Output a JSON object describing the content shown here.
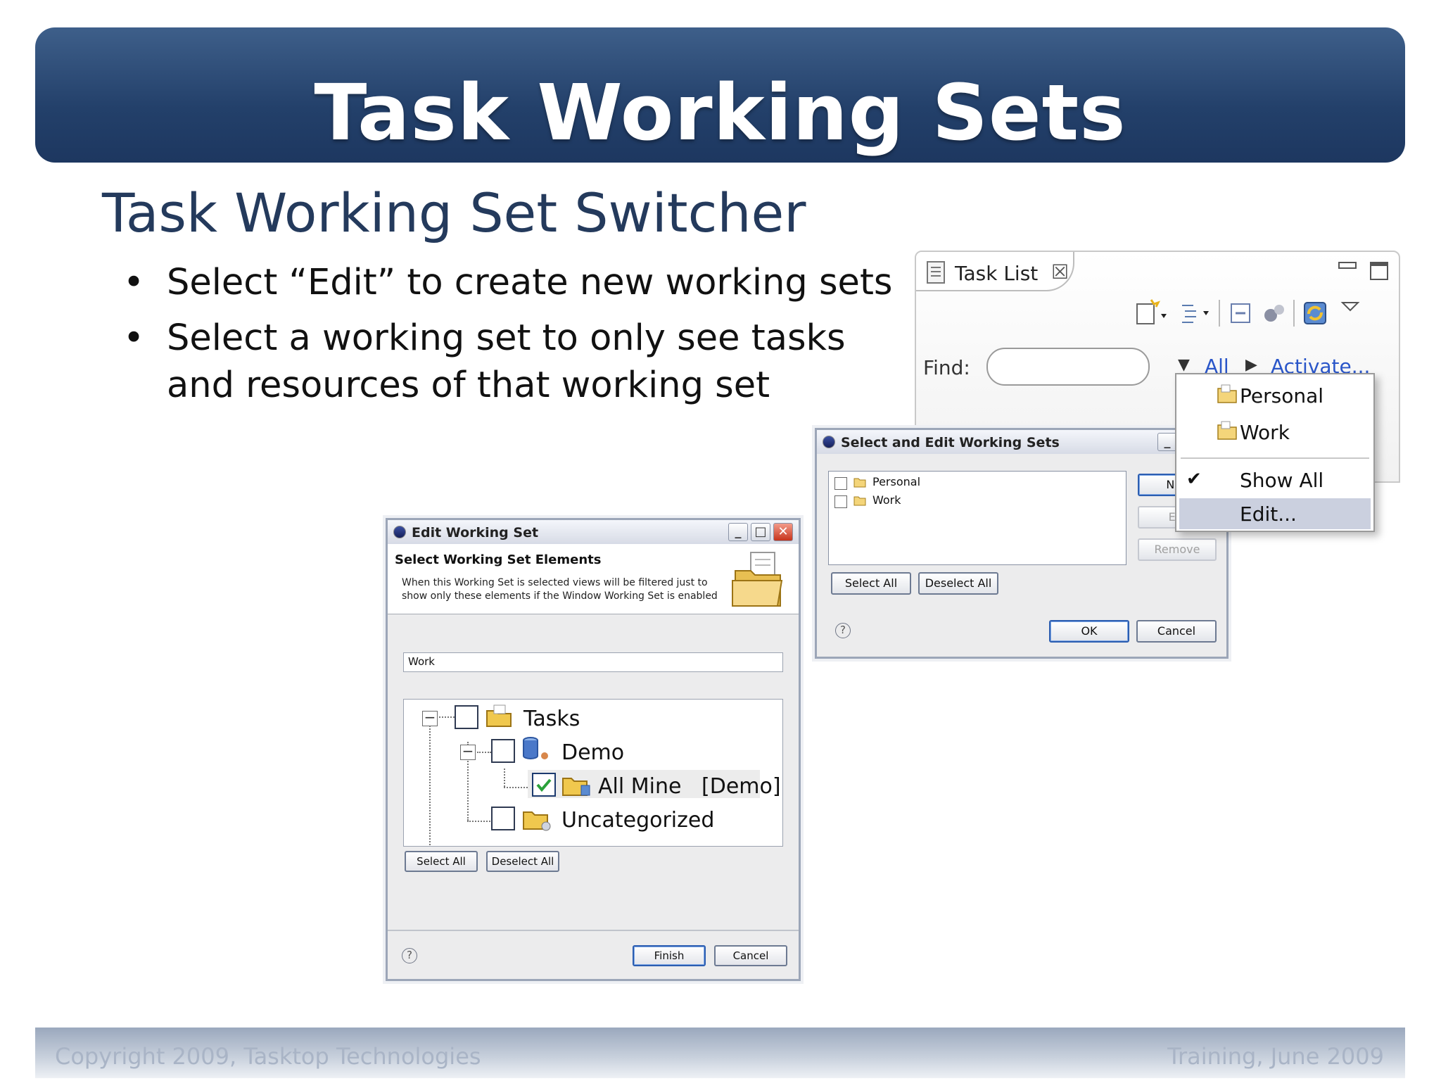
{
  "slide": {
    "title": "Task Working Sets",
    "subtitle": "Task Working Set Switcher",
    "bullets": [
      "Select “Edit” to create new working sets",
      "Select a working set to only see tasks and resources of that working set"
    ],
    "bullet_char": "•",
    "footer_left": "Copyright 2009, Tasktop Technologies",
    "footer_right": "Training, June 2009",
    "colors": {
      "title_bar": "#23406a",
      "subtitle": "#243a5c",
      "link": "#2a56c9",
      "menu_highlight": "#cbd0df"
    }
  },
  "task_list": {
    "tab_label": "Task List",
    "tab_close": "☒",
    "find_label": "Find:",
    "find_value": "",
    "filter_link": "All",
    "activate_link": "Activate...",
    "menu": {
      "items": [
        {
          "label": "Personal",
          "icon": "working-set-folder-icon",
          "checked": false
        },
        {
          "label": "Work",
          "icon": "working-set-folder-icon",
          "checked": false
        },
        {
          "label": "Show All",
          "checked": true
        },
        {
          "label": "Edit...",
          "highlighted": true
        }
      ]
    }
  },
  "select_edit_dialog": {
    "title": "Select and Edit Working Sets",
    "sets": [
      {
        "label": "Personal",
        "checked": false
      },
      {
        "label": "Work",
        "checked": false
      }
    ],
    "side_buttons": [
      "New...",
      "Edit...",
      "Remove"
    ],
    "side_buttons_visible": [
      "Nev",
      "Edi",
      "Remove"
    ],
    "select_all": "Select All",
    "deselect_all": "Deselect All",
    "ok": "OK",
    "cancel": "Cancel",
    "help": "?"
  },
  "edit_dialog": {
    "title": "Edit Working Set",
    "heading": "Select Working Set Elements",
    "description": "When this Working Set is selected views will be filtered just to show only these elements if the Window Working Set is enabled",
    "name_value": "Work",
    "tree": [
      {
        "label": "Tasks",
        "checked": false,
        "expanded": true,
        "icon": "tasks-folder-icon"
      },
      {
        "label": "Demo",
        "checked": false,
        "expanded": true,
        "icon": "repository-icon"
      },
      {
        "label": "All Mine   [Demo]",
        "checked": true,
        "icon": "query-folder-icon"
      },
      {
        "label": "Uncategorized",
        "checked": false,
        "icon": "category-folder-icon"
      }
    ],
    "select_all": "Select All",
    "deselect_all": "Deselect All",
    "finish": "Finish",
    "cancel": "Cancel",
    "help": "?"
  }
}
